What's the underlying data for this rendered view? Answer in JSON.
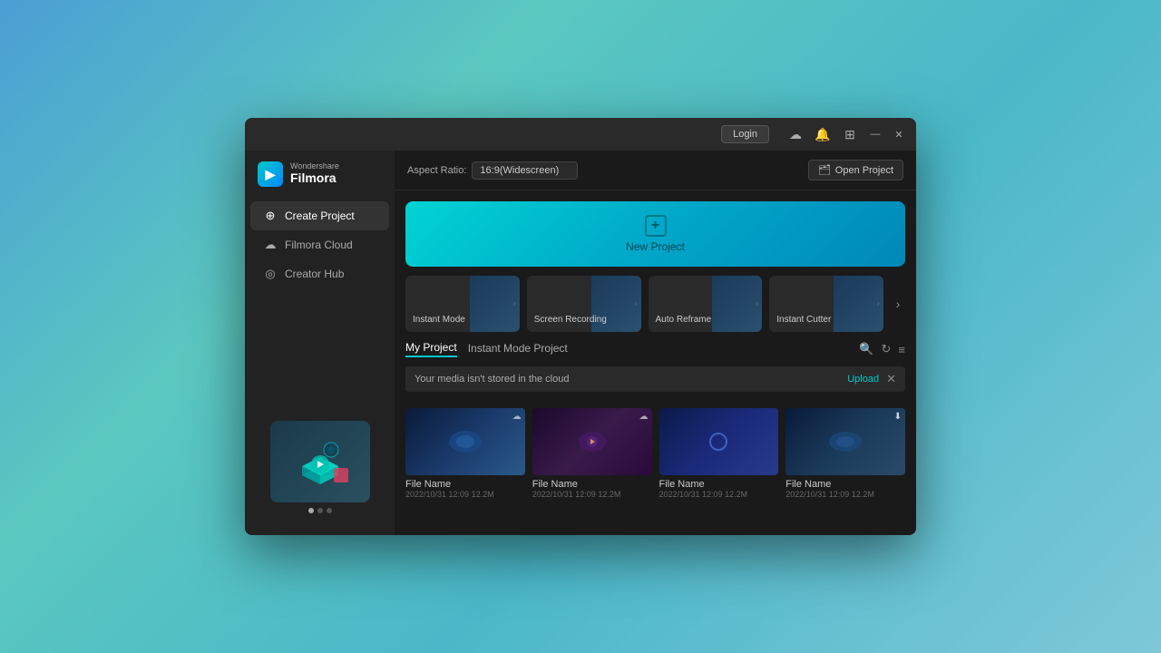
{
  "window": {
    "title": "Wondershare Filmora"
  },
  "titlebar": {
    "login_label": "Login",
    "minimize": "—",
    "close": "✕"
  },
  "logo": {
    "brand": "Wondershare",
    "name": "Filmora"
  },
  "sidebar": {
    "items": [
      {
        "id": "create-project",
        "label": "Create Project",
        "icon": "⊕",
        "active": true
      },
      {
        "id": "filmora-cloud",
        "label": "Filmora Cloud",
        "icon": "☁",
        "active": false
      },
      {
        "id": "creator-hub",
        "label": "Creator Hub",
        "icon": "◎",
        "active": false
      }
    ],
    "dots": [
      true,
      false,
      false
    ]
  },
  "topbar": {
    "aspect_ratio_label": "Aspect Ratio:",
    "aspect_value": "16:9(Widescreen)",
    "open_project_label": "Open Project"
  },
  "new_project": {
    "label": "New Project"
  },
  "quick_modes": [
    {
      "id": "instant-mode",
      "label": "Instant Mode"
    },
    {
      "id": "screen-recording",
      "label": "Screen Recording"
    },
    {
      "id": "auto-reframe",
      "label": "Auto Reframe"
    },
    {
      "id": "instant-cutter",
      "label": "Instant Cutter"
    }
  ],
  "projects": {
    "tab_my": "My Project",
    "tab_instant": "Instant Mode Project",
    "cloud_banner": "Your media isn't stored in the cloud",
    "upload_label": "Upload",
    "files": [
      {
        "name": "File Name",
        "date": "2022/10/31 12:09",
        "size": "12.2M",
        "type": "blue-gradient"
      },
      {
        "name": "File Name",
        "date": "2022/10/31 12:09",
        "size": "12.2M",
        "type": "purple-dark"
      },
      {
        "name": "File Name",
        "date": "2022/10/31 12:09",
        "size": "12.2M",
        "type": "blue-dark"
      },
      {
        "name": "File Name",
        "date": "2022/10/31 12:09",
        "size": "12.2M",
        "type": "blue-gradient2"
      }
    ]
  }
}
